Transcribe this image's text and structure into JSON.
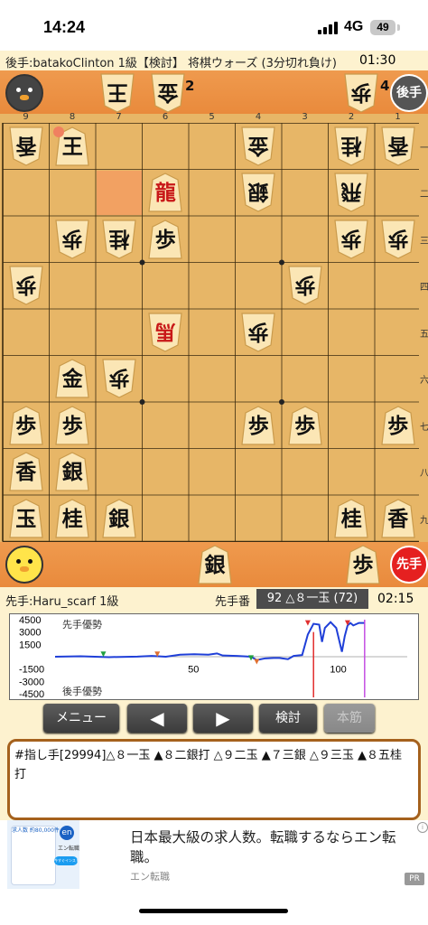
{
  "status_bar": {
    "time": "14:24",
    "network": "4G",
    "battery": "49"
  },
  "gote": {
    "header": "後手:batakoClinton 1級【検討】 将棋ウォーズ (3分切れ負け)",
    "clock": "01:30",
    "badge": "後手",
    "hand": [
      {
        "piece": "歩",
        "count": "4"
      },
      {
        "piece": "王",
        "count": ""
      },
      {
        "piece": "金",
        "count": "2"
      }
    ]
  },
  "board": {
    "file_labels": [
      "9",
      "8",
      "7",
      "6",
      "5",
      "4",
      "3",
      "2",
      "1"
    ],
    "rank_labels": [
      "一",
      "二",
      "三",
      "四",
      "五",
      "六",
      "七",
      "八",
      "九"
    ],
    "pieces": [
      {
        "file": 9,
        "rank": 1,
        "label": "香",
        "side": "gote"
      },
      {
        "file": 8,
        "rank": 1,
        "label": "王",
        "side": "sente"
      },
      {
        "file": 4,
        "rank": 1,
        "label": "金",
        "side": "gote"
      },
      {
        "file": 2,
        "rank": 1,
        "label": "桂",
        "side": "gote"
      },
      {
        "file": 1,
        "rank": 1,
        "label": "香",
        "side": "gote"
      },
      {
        "file": 6,
        "rank": 2,
        "label": "龍",
        "side": "sente",
        "red": true
      },
      {
        "file": 4,
        "rank": 2,
        "label": "銀",
        "side": "gote"
      },
      {
        "file": 2,
        "rank": 2,
        "label": "飛",
        "side": "gote"
      },
      {
        "file": 8,
        "rank": 3,
        "label": "歩",
        "side": "gote"
      },
      {
        "file": 7,
        "rank": 3,
        "label": "桂",
        "side": "gote"
      },
      {
        "file": 6,
        "rank": 3,
        "label": "歩",
        "side": "sente"
      },
      {
        "file": 2,
        "rank": 3,
        "label": "歩",
        "side": "gote"
      },
      {
        "file": 1,
        "rank": 3,
        "label": "歩",
        "side": "gote"
      },
      {
        "file": 9,
        "rank": 4,
        "label": "歩",
        "side": "gote"
      },
      {
        "file": 3,
        "rank": 4,
        "label": "歩",
        "side": "gote"
      },
      {
        "file": 6,
        "rank": 5,
        "label": "馬",
        "side": "gote",
        "red": true
      },
      {
        "file": 4,
        "rank": 5,
        "label": "歩",
        "side": "gote"
      },
      {
        "file": 8,
        "rank": 6,
        "label": "金",
        "side": "sente"
      },
      {
        "file": 7,
        "rank": 6,
        "label": "歩",
        "side": "gote"
      },
      {
        "file": 9,
        "rank": 7,
        "label": "歩",
        "side": "sente"
      },
      {
        "file": 8,
        "rank": 7,
        "label": "歩",
        "side": "sente"
      },
      {
        "file": 4,
        "rank": 7,
        "label": "歩",
        "side": "sente"
      },
      {
        "file": 3,
        "rank": 7,
        "label": "歩",
        "side": "sente"
      },
      {
        "file": 1,
        "rank": 7,
        "label": "歩",
        "side": "sente"
      },
      {
        "file": 9,
        "rank": 8,
        "label": "香",
        "side": "sente"
      },
      {
        "file": 8,
        "rank": 8,
        "label": "銀",
        "side": "sente"
      },
      {
        "file": 9,
        "rank": 9,
        "label": "玉",
        "side": "sente"
      },
      {
        "file": 8,
        "rank": 9,
        "label": "桂",
        "side": "sente"
      },
      {
        "file": 7,
        "rank": 9,
        "label": "銀",
        "side": "sente"
      },
      {
        "file": 2,
        "rank": 9,
        "label": "桂",
        "side": "sente"
      },
      {
        "file": 1,
        "rank": 9,
        "label": "香",
        "side": "sente"
      }
    ],
    "highlight": {
      "file": 7,
      "rank": 2
    },
    "marker": {
      "file": 8,
      "rank": 1
    }
  },
  "sente": {
    "name": "先手:Haru_scarf 1級",
    "turn_label": "先手番",
    "move_display": "92 △８一玉 (72)",
    "clock": "02:15",
    "badge": "先手",
    "hand": [
      {
        "piece": "銀",
        "count": ""
      },
      {
        "piece": "歩",
        "count": ""
      }
    ]
  },
  "graph": {
    "y_labels": [
      "4500",
      "3000",
      "1500",
      "-1500",
      "-3000",
      "-4500"
    ],
    "x_ticks": [
      "50",
      "100"
    ],
    "top_label": "先手優勢",
    "bottom_label": "後手優勢",
    "line_color": "#1f3fd8",
    "current_move_color": "#e02020",
    "end_marker_color": "#c040e0"
  },
  "chart_data": {
    "type": "line",
    "title": "",
    "xlabel": "",
    "ylabel": "",
    "ylim": [
      -4500,
      4500
    ],
    "xlim": [
      1,
      125
    ],
    "x": [
      1,
      10,
      20,
      30,
      35,
      40,
      45,
      50,
      55,
      58,
      60,
      65,
      70,
      72,
      75,
      78,
      80,
      83,
      85,
      88,
      90,
      92,
      94,
      95,
      96,
      98,
      100,
      102,
      103,
      104,
      105,
      106,
      108,
      110
    ],
    "series": [
      {
        "name": "",
        "values": [
          0,
          50,
          -50,
          20,
          100,
          0,
          250,
          300,
          250,
          400,
          150,
          100,
          0,
          -400,
          -200,
          -150,
          -150,
          -300,
          100,
          200,
          2700,
          4000,
          3900,
          1800,
          3500,
          4200,
          3500,
          600,
          2500,
          3800,
          4100,
          3800,
          4100,
          4100
        ]
      }
    ],
    "current_move": 92,
    "last_move": 110
  },
  "buttons": {
    "menu": "メニュー",
    "prev": "◀",
    "next": "▶",
    "analyze": "検討",
    "main_line": "本筋"
  },
  "kifu": {
    "text": "#指し手[29994]△８一玉 ▲８二銀打 △９二玉 ▲７三銀 △９三玉 ▲８五桂打"
  },
  "ad": {
    "title": "日本最大級の求人数。転職するならエン転職。",
    "source": "エン転職",
    "pr": "PR",
    "thumb_text": "求人数 約80,000件",
    "app_name": "エン転職",
    "install": "今すぐインストール"
  }
}
